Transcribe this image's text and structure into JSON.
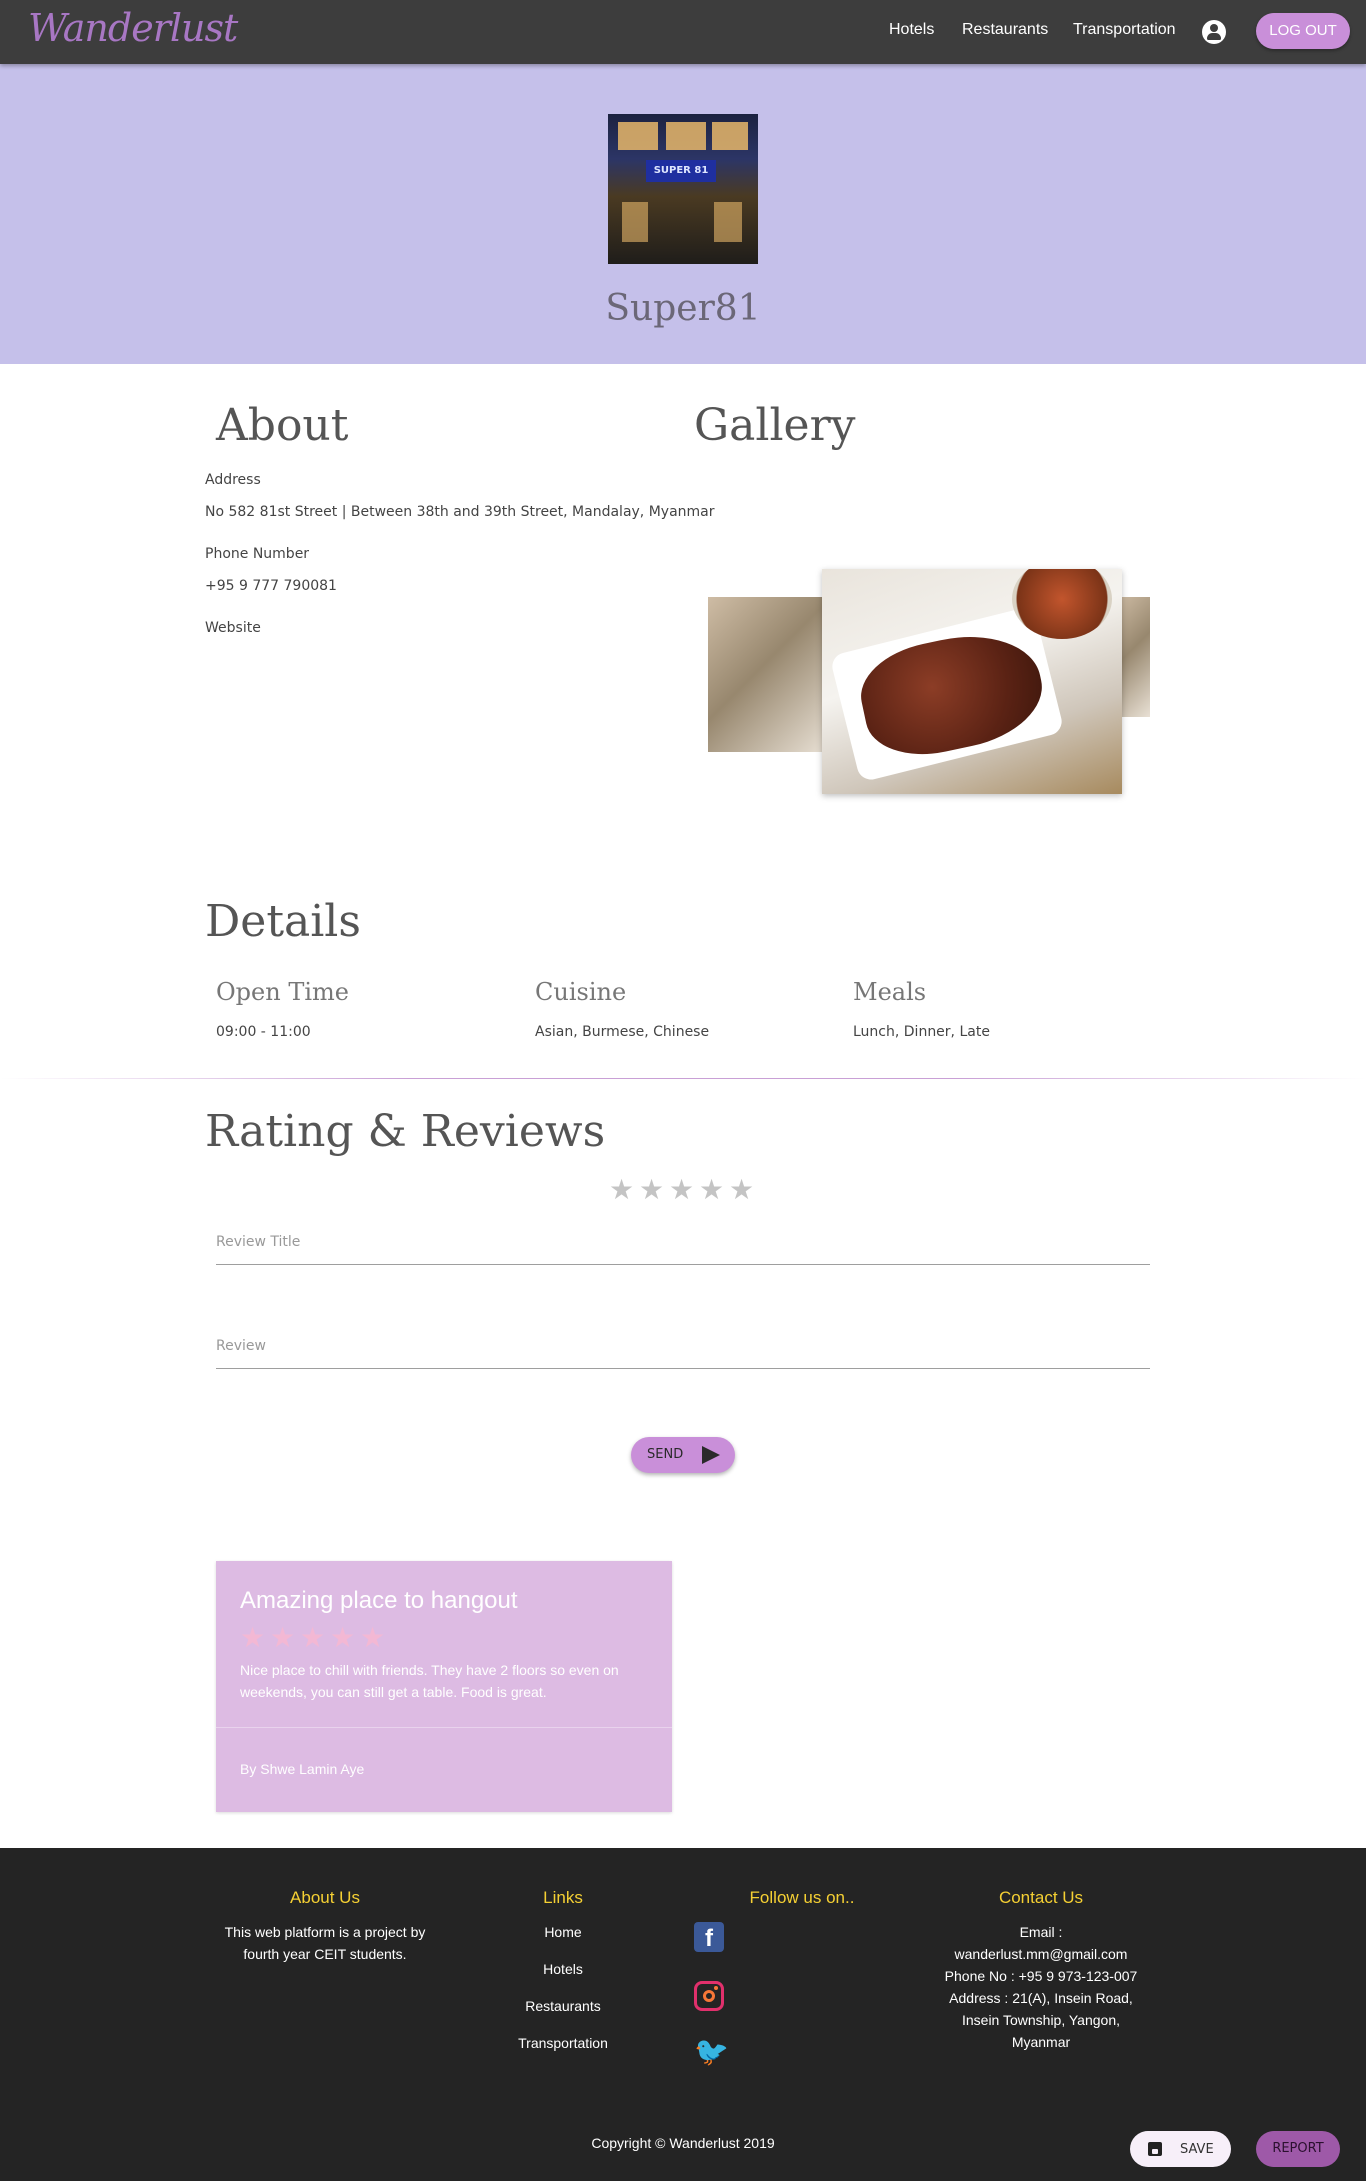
{
  "nav": {
    "logo": "Wanderlust",
    "links": [
      "Hotels",
      "Restaurants",
      "Transportation"
    ],
    "logout_label": "LOG OUT"
  },
  "hero": {
    "title": "Super81",
    "sign_text": "SUPER 81"
  },
  "about": {
    "heading": "About",
    "address_label": "Address",
    "address": "No 582 81st Street | Between 38th and 39th Street, Mandalay, Myanmar",
    "phone_label": "Phone Number",
    "phone": "+95 9 777 790081",
    "website_label": "Website"
  },
  "gallery": {
    "heading": "Gallery"
  },
  "details": {
    "heading": "Details",
    "items": [
      {
        "title": "Open Time",
        "value": "09:00 - 11:00"
      },
      {
        "title": "Cuisine",
        "value": "Asian, Burmese, Chinese"
      },
      {
        "title": "Meals",
        "value": "Lunch, Dinner, Late"
      }
    ]
  },
  "rating": {
    "heading": "Rating & Reviews",
    "stars_selected": 0,
    "stars_max": 5,
    "title_placeholder": "Review Title",
    "review_placeholder": "Review",
    "send_label": "SEND"
  },
  "reviews": [
    {
      "title": "Amazing place to hangout",
      "stars": 5,
      "text": "Nice place to chill with friends. They have 2 floors so even on weekends, you can still get a table. Food is great.",
      "author": "By Shwe Lamin Aye"
    }
  ],
  "footer": {
    "about_heading": "About Us",
    "about_text": "This web platform is a project by fourth year CEIT students.",
    "links_heading": "Links",
    "links": [
      "Home",
      "Hotels",
      "Restaurants",
      "Transportation"
    ],
    "follow_heading": "Follow us on..",
    "social": [
      "facebook-icon",
      "instagram-icon",
      "twitter-icon"
    ],
    "contact_heading": "Contact Us",
    "contact_lines": [
      "Email :",
      "wanderlust.mm@gmail.com",
      "Phone No : +95 9 973-123-007",
      "Address : 21(A), Insein Road,",
      "Insein Township, Yangon,",
      "Myanmar"
    ],
    "copyright": "Copyright © Wanderlust 2019"
  },
  "actions": {
    "save_label": "SAVE",
    "report_label": "REPORT"
  },
  "colors": {
    "accent": "#c98fd9",
    "hero_bg": "#c5c0ea",
    "card_bg": "#ddbbe3",
    "footer_heading": "#f5d033"
  }
}
